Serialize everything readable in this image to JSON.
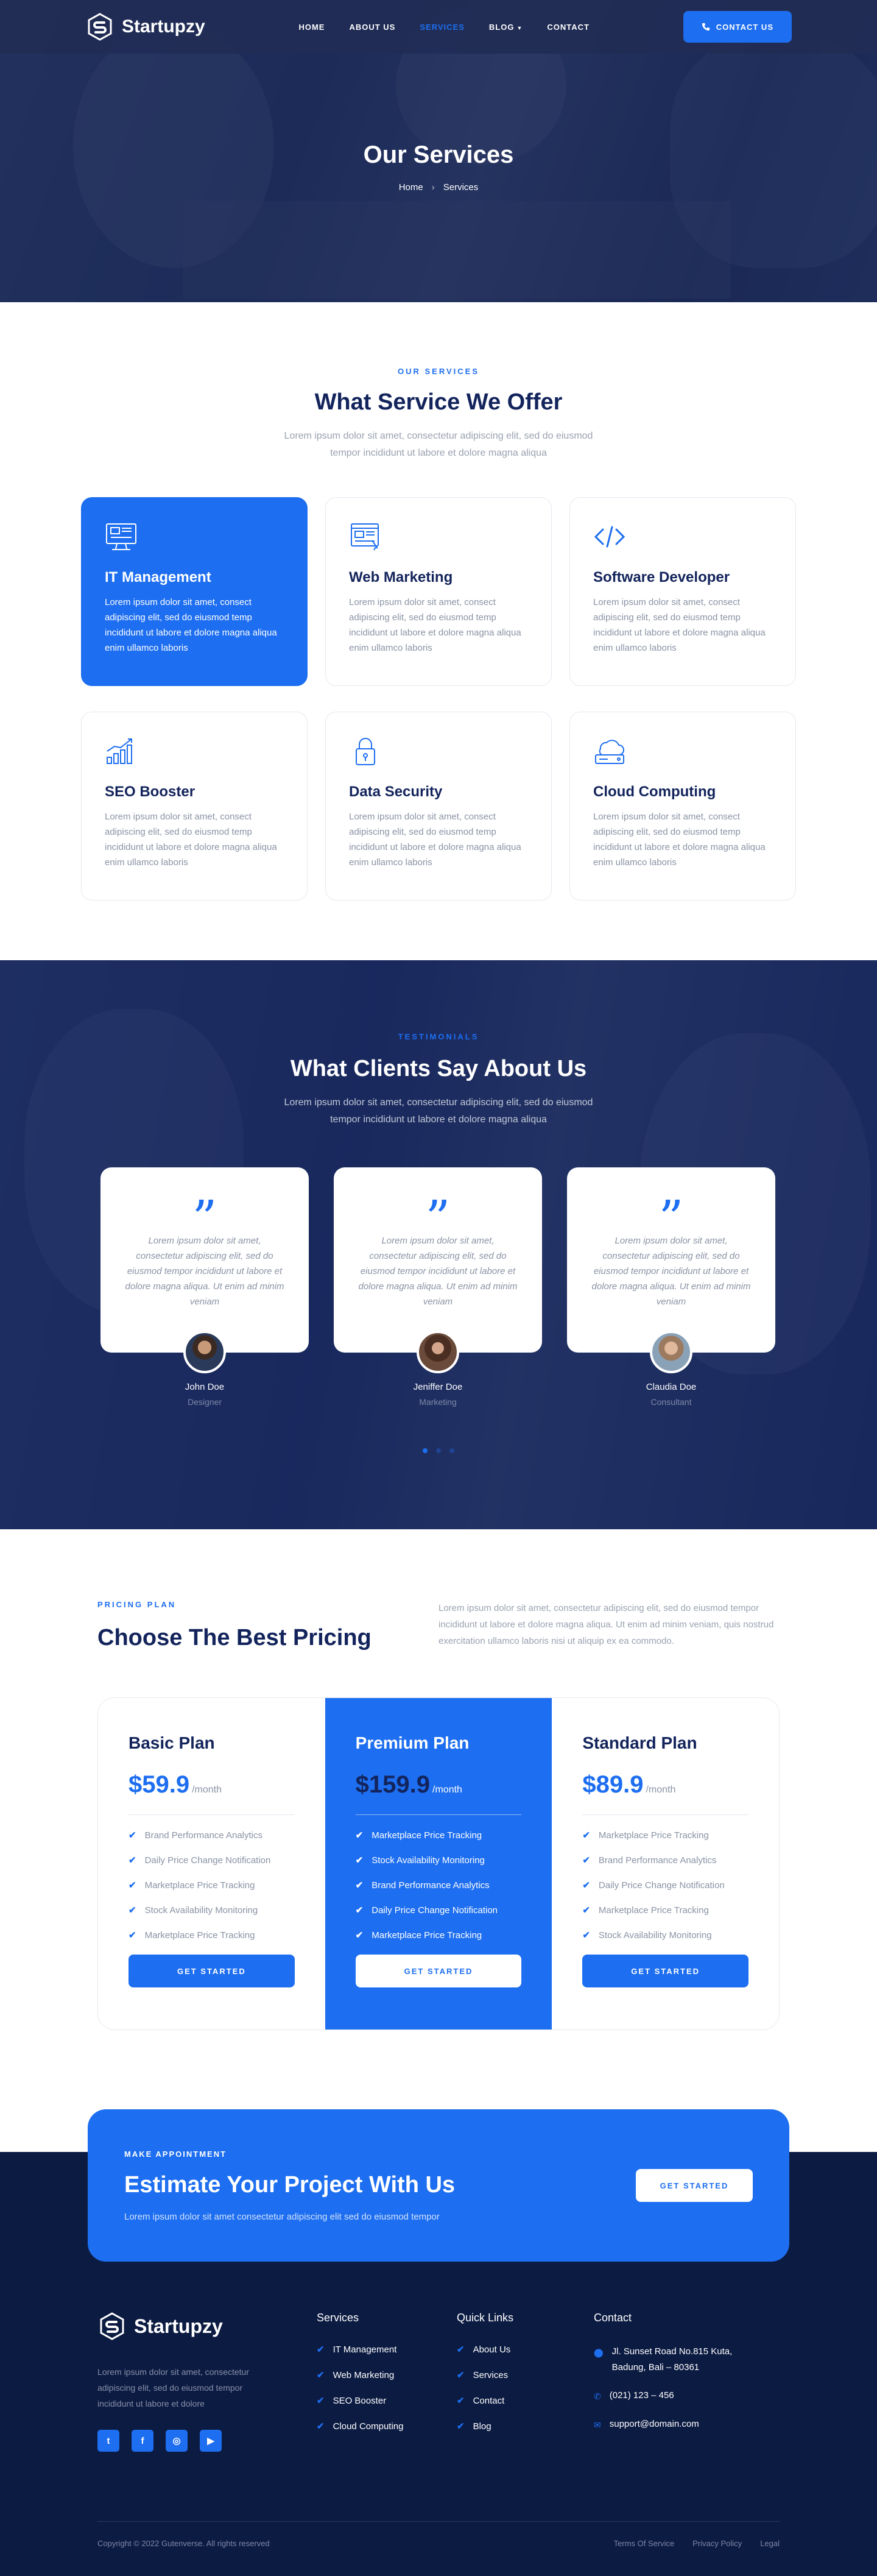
{
  "brand": {
    "name": "Startupzy"
  },
  "nav": {
    "items": [
      {
        "label": "HOME"
      },
      {
        "label": "ABOUT US"
      },
      {
        "label": "SERVICES",
        "active": true
      },
      {
        "label": "BLOG"
      },
      {
        "label": "CONTACT"
      }
    ],
    "cta": "CONTACT US"
  },
  "hero": {
    "title": "Our Services",
    "breadcrumb": [
      "Home",
      "Services"
    ]
  },
  "services": {
    "label": "OUR SERVICES",
    "title": "What Service We Offer",
    "desc": "Lorem ipsum dolor sit amet, consectetur adipiscing elit, sed do eiusmod tempor incididunt ut labore et dolore magna aliqua",
    "items": [
      {
        "title": "IT Management",
        "desc": "Lorem ipsum dolor sit amet, consect adipiscing elit, sed do eiusmod temp incididunt ut labore et dolore magna aliqua enim ullamco laboris",
        "icon": "monitor-icon"
      },
      {
        "title": "Web Marketing",
        "desc": "Lorem ipsum dolor sit amet, consect adipiscing elit, sed do eiusmod temp incididunt ut labore et dolore magna aliqua enim ullamco laboris",
        "icon": "web-icon"
      },
      {
        "title": "Software Developer",
        "desc": "Lorem ipsum dolor sit amet, consect adipiscing elit, sed do eiusmod temp incididunt ut labore et dolore magna aliqua enim ullamco laboris",
        "icon": "code-icon"
      },
      {
        "title": "SEO Booster",
        "desc": "Lorem ipsum dolor sit amet, consect adipiscing elit, sed do eiusmod temp incididunt ut labore et dolore magna aliqua enim ullamco laboris",
        "icon": "chart-icon"
      },
      {
        "title": "Data Security",
        "desc": "Lorem ipsum dolor sit amet, consect adipiscing elit, sed do eiusmod temp incididunt ut labore et dolore magna aliqua enim ullamco laboris",
        "icon": "lock-icon"
      },
      {
        "title": "Cloud Computing",
        "desc": "Lorem ipsum dolor sit amet, consect adipiscing elit, sed do eiusmod temp incididunt ut labore et dolore magna aliqua enim ullamco laboris",
        "icon": "cloud-icon"
      }
    ]
  },
  "testimonials": {
    "label": "TESTIMONIALS",
    "title": "What Clients Say About Us",
    "desc": "Lorem ipsum dolor sit amet, consectetur adipiscing elit, sed do eiusmod tempor incididunt ut labore et dolore magna aliqua",
    "items": [
      {
        "quote": "Lorem ipsum dolor sit amet, consectetur adipiscing elit, sed do eiusmod tempor incididunt ut labore et dolore magna aliqua. Ut enim ad minim veniam",
        "name": "John Doe",
        "role": "Designer"
      },
      {
        "quote": "Lorem ipsum dolor sit amet, consectetur adipiscing elit, sed do eiusmod tempor incididunt ut labore et dolore magna aliqua. Ut enim ad minim veniam",
        "name": "Jeniffer Doe",
        "role": "Marketing"
      },
      {
        "quote": "Lorem ipsum dolor sit amet, consectetur adipiscing elit, sed do eiusmod tempor incididunt ut labore et dolore magna aliqua. Ut enim ad minim veniam",
        "name": "Claudia Doe",
        "role": "Consultant"
      }
    ]
  },
  "pricing": {
    "label": "PRICING PLAN",
    "title": "Choose The Best Pricing",
    "desc": "Lorem ipsum dolor sit amet, consectetur adipiscing elit, sed do eiusmod tempor incididunt ut labore et dolore magna aliqua. Ut enim ad minim veniam, quis nostrud exercitation ullamco laboris nisi ut aliquip ex ea commodo.",
    "plans": [
      {
        "name": "Basic Plan",
        "price": "$59.9",
        "period": "/month",
        "features": [
          "Brand Performance Analytics",
          "Daily Price Change Notification",
          "Marketplace Price Tracking",
          "Stock Availability Monitoring",
          "Marketplace Price Tracking"
        ],
        "button": "GET STARTED"
      },
      {
        "name": "Premium Plan",
        "price": "$159.9",
        "period": "/month",
        "features": [
          "Marketplace Price Tracking",
          "Stock Availability Monitoring",
          "Brand Performance Analytics",
          "Daily Price Change Notification",
          "Marketplace Price Tracking"
        ],
        "button": "GET STARTED"
      },
      {
        "name": "Standard Plan",
        "price": "$89.9",
        "period": "/month",
        "features": [
          "Marketplace Price Tracking",
          "Brand Performance Analytics",
          "Daily Price Change Notification",
          "Marketplace Price Tracking",
          "Stock Availability Monitoring"
        ],
        "button": "GET STARTED"
      }
    ]
  },
  "cta": {
    "label": "MAKE APPOINTMENT",
    "title": "Estimate Your Project With Us",
    "desc": "Lorem ipsum dolor sit amet consectetur adipiscing elit sed do eiusmod tempor",
    "button": "GET STARTED"
  },
  "footer": {
    "about": "Lorem ipsum dolor sit amet, consectetur adipiscing elit, sed do eiusmod tempor incididunt ut labore et dolore",
    "services_title": "Services",
    "services": [
      "IT Management",
      "Web Marketing",
      "SEO Booster",
      "Cloud Computing"
    ],
    "links_title": "Quick Links",
    "links": [
      "About Us",
      "Services",
      "Contact",
      "Blog"
    ],
    "contact_title": "Contact",
    "address": "Jl. Sunset Road No.815 Kuta, Badung, Bali – 80361",
    "phone": "(021) 123 – 456",
    "email": "support@domain.com",
    "copyright": "Copyright © 2022 Gutenverse. All rights reserved",
    "legal": [
      "Terms Of Service",
      "Privacy Policy",
      "Legal"
    ]
  },
  "colors": {
    "primary": "#1d6ef0",
    "navy": "#13245c",
    "footer": "#0c1b42"
  }
}
